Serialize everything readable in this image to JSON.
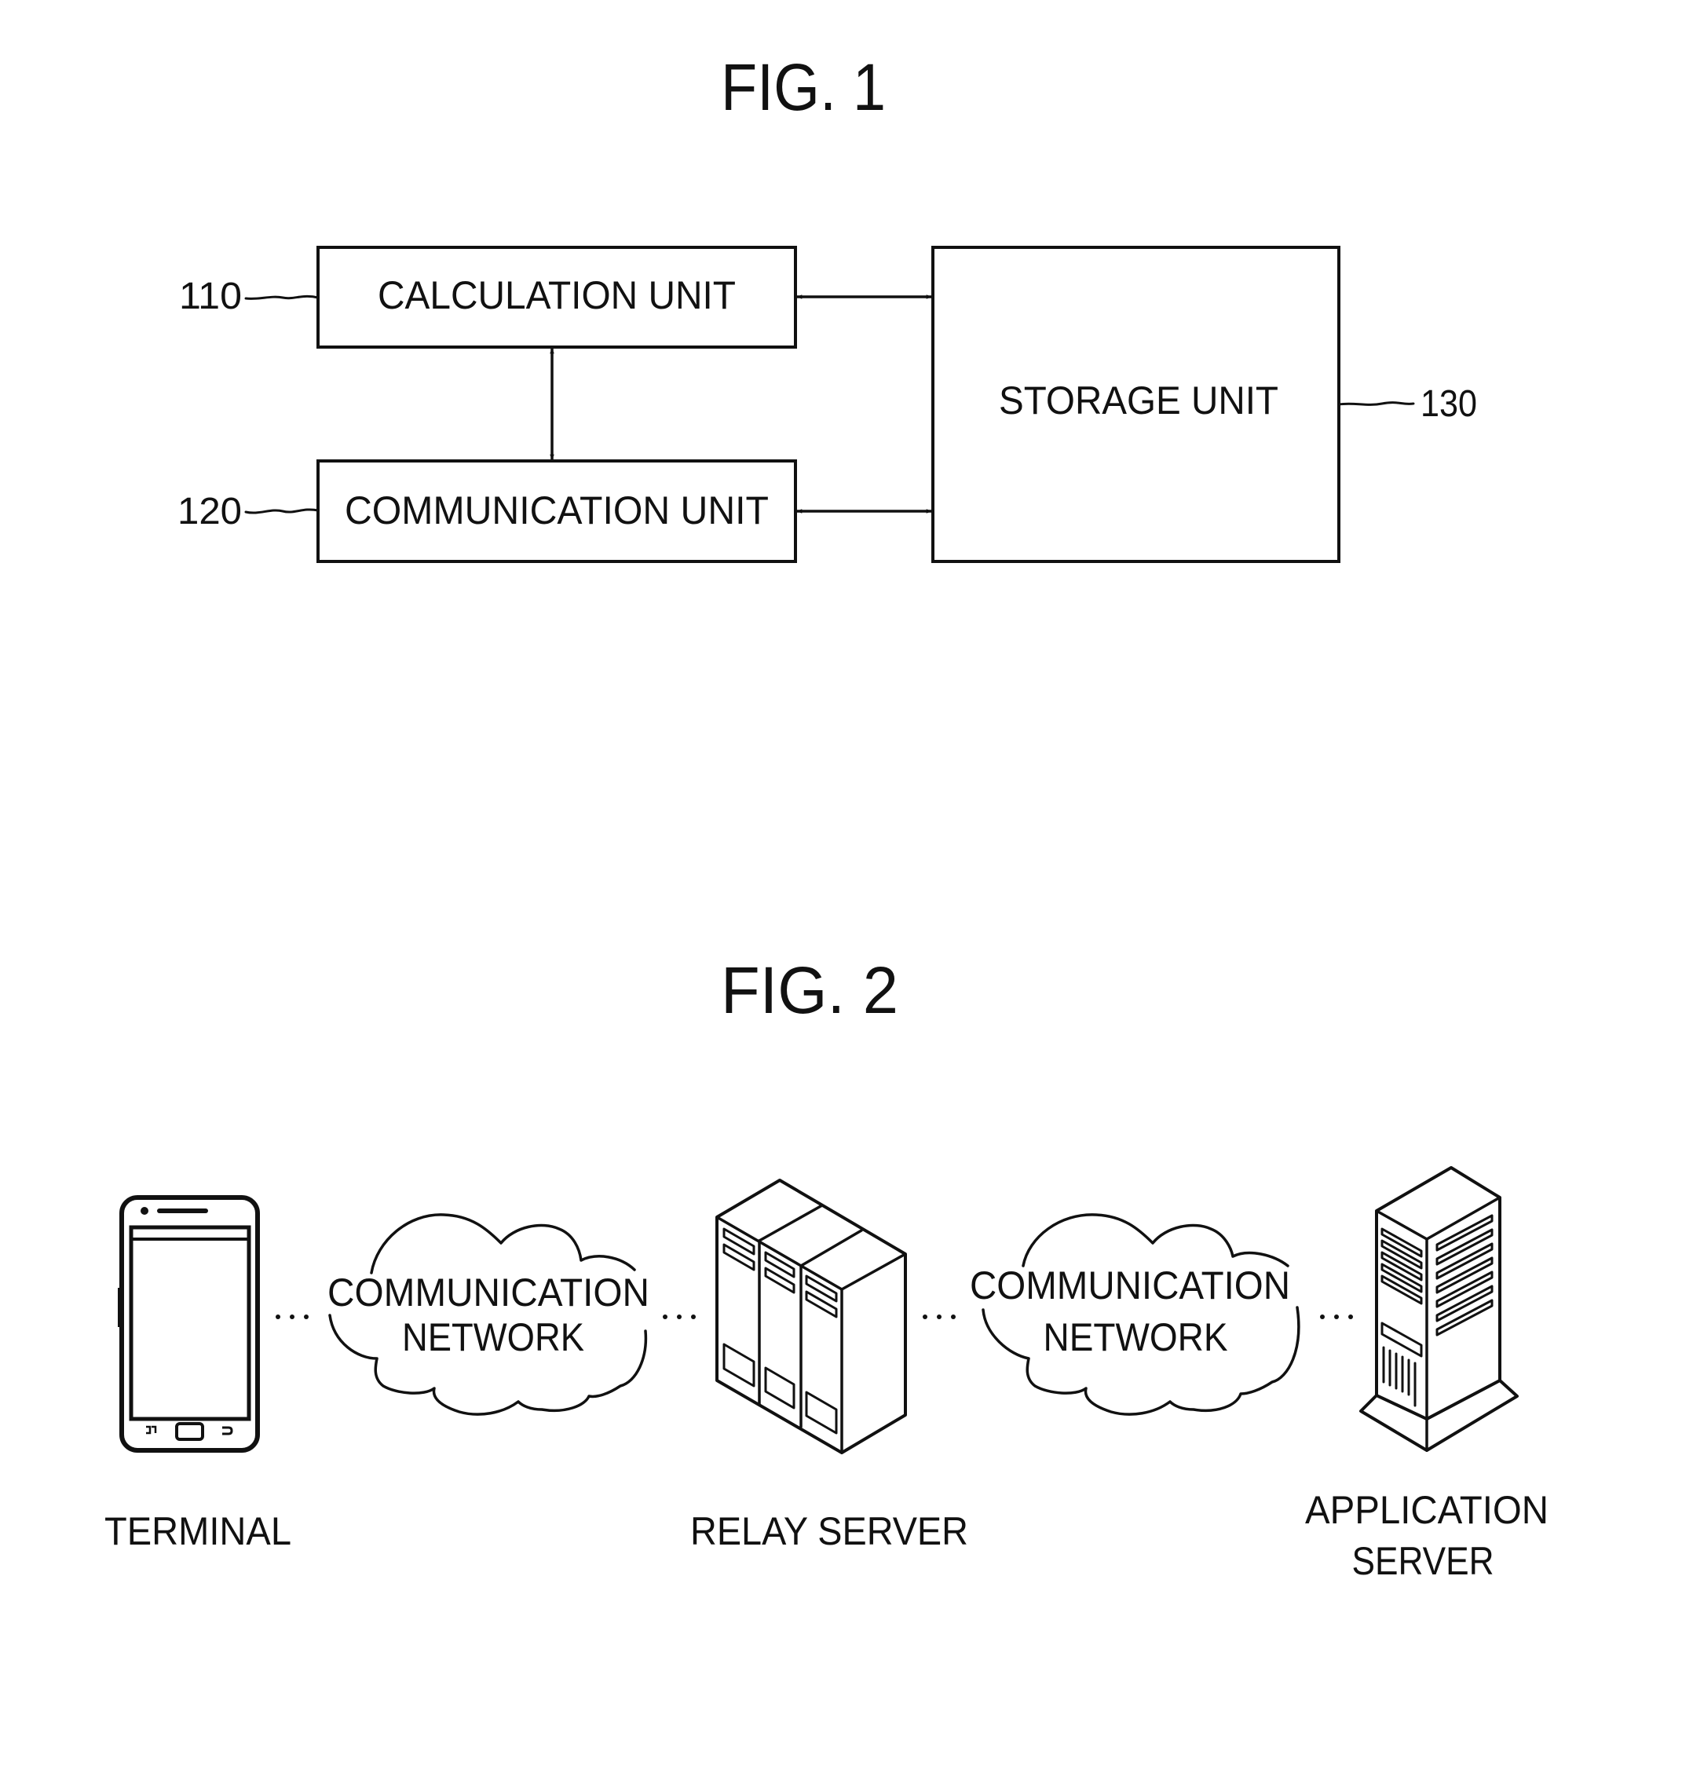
{
  "fig1": {
    "title": "FIG. 1",
    "blocks": [
      {
        "ref": "110",
        "label": "CALCULATION UNIT"
      },
      {
        "ref": "120",
        "label": "COMMUNICATION UNIT"
      },
      {
        "ref": "130",
        "label": "STORAGE UNIT"
      }
    ],
    "connections": [
      {
        "from": "CALCULATION UNIT",
        "to": "STORAGE UNIT",
        "type": "bidirectional"
      },
      {
        "from": "COMMUNICATION UNIT",
        "to": "STORAGE UNIT",
        "type": "bidirectional"
      },
      {
        "from": "CALCULATION UNIT",
        "to": "COMMUNICATION UNIT",
        "type": "bidirectional"
      }
    ]
  },
  "fig2": {
    "title": "FIG. 2",
    "nodes": [
      {
        "label": "TERMINAL",
        "icon": "smartphone-icon"
      },
      {
        "label_line1": "COMMUNICATION",
        "label_line2": "NETWORK",
        "icon": "cloud-icon"
      },
      {
        "label": "RELAY SERVER",
        "icon": "server-rack-icon"
      },
      {
        "label_line1": "COMMUNICATION",
        "label_line2": "NETWORK",
        "icon": "cloud-icon"
      },
      {
        "label_line1": "APPLICATION",
        "label_line2": "SERVER",
        "icon": "tower-server-icon"
      }
    ],
    "link_style": "dotted"
  }
}
